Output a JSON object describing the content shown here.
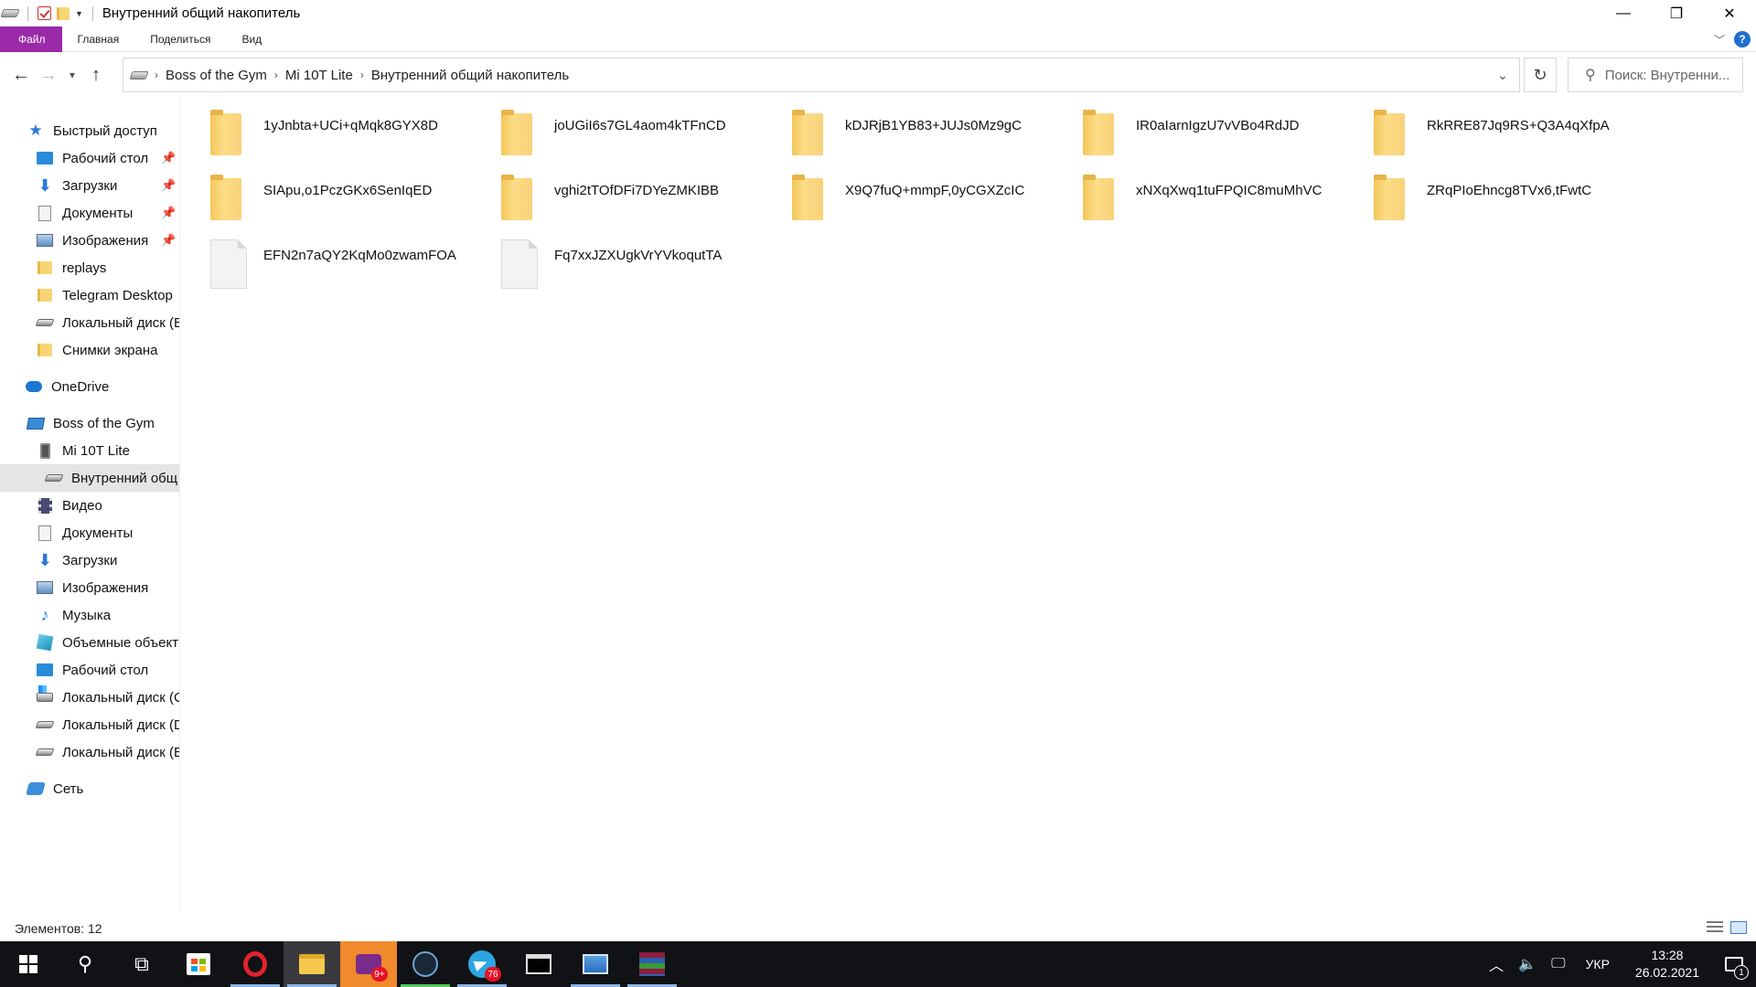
{
  "window": {
    "title": "Внутренний общий накопитель",
    "controls": {
      "minimize": "—",
      "maximize": "❐",
      "close": "✕"
    }
  },
  "ribbon": {
    "tabs": [
      "Файл",
      "Главная",
      "Поделиться",
      "Вид"
    ],
    "help": "?"
  },
  "address": {
    "crumbs": [
      "Boss of the Gym",
      "Mi 10T Lite",
      "Внутренний общий накопитель"
    ],
    "search_placeholder": "Поиск: Внутренни..."
  },
  "sidebar": {
    "items": [
      {
        "label": "Быстрый доступ",
        "icon": "star-icon",
        "pinned": false
      },
      {
        "label": "Рабочий стол",
        "icon": "desktop-icon",
        "pinned": true
      },
      {
        "label": "Загрузки",
        "icon": "download-icon",
        "pinned": true
      },
      {
        "label": "Документы",
        "icon": "document-icon",
        "pinned": true
      },
      {
        "label": "Изображения",
        "icon": "pictures-icon",
        "pinned": true
      },
      {
        "label": "replays",
        "icon": "folder-icon",
        "pinned": false
      },
      {
        "label": "Telegram Desktop",
        "icon": "folder-icon",
        "pinned": false
      },
      {
        "label": "Локальный диск (E",
        "icon": "drive-icon",
        "pinned": false
      },
      {
        "label": "Снимки экрана",
        "icon": "folder-icon",
        "pinned": false
      },
      {
        "label": "OneDrive",
        "icon": "onedrive-icon",
        "pinned": false
      },
      {
        "label": "Boss of the Gym",
        "icon": "computer-icon",
        "pinned": false
      },
      {
        "label": "Mi 10T Lite",
        "icon": "phone-icon",
        "pinned": false
      },
      {
        "label": "Внутренний общ",
        "icon": "drive-icon",
        "pinned": false,
        "selected": true
      },
      {
        "label": "Видео",
        "icon": "video-icon",
        "pinned": false
      },
      {
        "label": "Документы",
        "icon": "document-icon",
        "pinned": false
      },
      {
        "label": "Загрузки",
        "icon": "download-icon",
        "pinned": false
      },
      {
        "label": "Изображения",
        "icon": "pictures-icon",
        "pinned": false
      },
      {
        "label": "Музыка",
        "icon": "music-icon",
        "pinned": false
      },
      {
        "label": "Объемные объект",
        "icon": "3d-objects-icon",
        "pinned": false
      },
      {
        "label": "Рабочий стол",
        "icon": "desktop-icon",
        "pinned": false
      },
      {
        "label": "Локальный диск (C",
        "icon": "system-drive-icon",
        "pinned": false
      },
      {
        "label": "Локальный диск (D",
        "icon": "drive-icon",
        "pinned": false
      },
      {
        "label": "Локальный диск (E",
        "icon": "drive-icon",
        "pinned": false
      },
      {
        "label": "Сеть",
        "icon": "network-icon",
        "pinned": false
      }
    ]
  },
  "files": [
    {
      "name": "1yJnbta+UCi+qMqk8GYX8D",
      "type": "folder"
    },
    {
      "name": "joUGiI6s7GL4aom4kTFnCD",
      "type": "folder"
    },
    {
      "name": "kDJRjB1YB83+JUJs0Mz9gC",
      "type": "folder"
    },
    {
      "name": "IR0aIarnIgzU7vVBo4RdJD",
      "type": "folder"
    },
    {
      "name": "RkRRE87Jq9RS+Q3A4qXfpA",
      "type": "folder"
    },
    {
      "name": "SIApu,o1PczGKx6SenIqED",
      "type": "folder"
    },
    {
      "name": "vghi2tTOfDFi7DYeZMKIBB",
      "type": "folder"
    },
    {
      "name": "X9Q7fuQ+mmpF,0yCGXZcIC",
      "type": "folder"
    },
    {
      "name": "xNXqXwq1tuFPQIC8muMhVC",
      "type": "folder"
    },
    {
      "name": "ZRqPIoEhncg8TVx6,tFwtC",
      "type": "folder"
    },
    {
      "name": "EFN2n7aQY2KqMo0zwamFOA",
      "type": "file"
    },
    {
      "name": "Fq7xxJZXUgkVrYVkoqutTA",
      "type": "file"
    }
  ],
  "status": {
    "count": "Элементов: 12"
  },
  "taskbar": {
    "badges": {
      "game": "9+",
      "telegram": "76"
    },
    "language": "УКР",
    "time": "13:28",
    "date": "26.02.2021",
    "notifications": "1"
  }
}
